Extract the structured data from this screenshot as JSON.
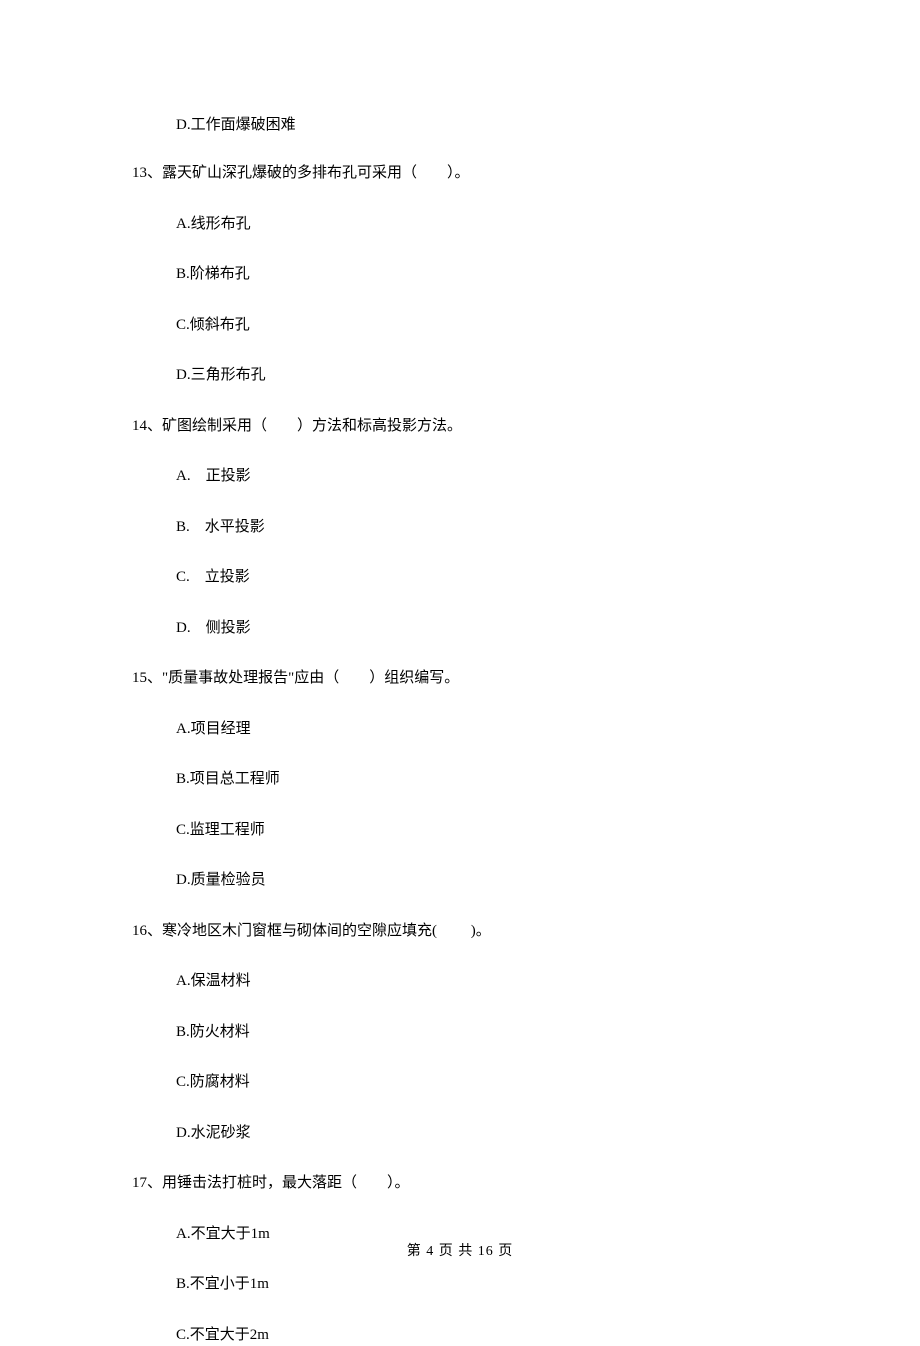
{
  "pre": {
    "option_d": "D.工作面爆破困难"
  },
  "q13": {
    "text": "13、露天矿山深孔爆破的多排布孔可采用（　　）。",
    "a": "A.线形布孔",
    "b": "B.阶梯布孔",
    "c": "C.倾斜布孔",
    "d": "D.三角形布孔"
  },
  "q14": {
    "text": "14、矿图绘制采用（　　）方法和标高投影方法。",
    "a": "A.　正投影",
    "b": "B.　水平投影",
    "c": "C.　立投影",
    "d": "D.　侧投影"
  },
  "q15": {
    "text": "15、\"质量事故处理报告\"应由（　　）组织编写。",
    "a": "A.项目经理",
    "b": "B.项目总工程师",
    "c": "C.监理工程师",
    "d": "D.质量检验员"
  },
  "q16": {
    "text": "16、寒冷地区木门窗框与砌体间的空隙应填充(　　 )。",
    "a": "A.保温材料",
    "b": "B.防火材料",
    "c": "C.防腐材料",
    "d": "D.水泥砂浆"
  },
  "q17": {
    "text": "17、用锤击法打桩时，最大落距（　　）。",
    "a": "A.不宜大于1m",
    "b": "B.不宜小于1m",
    "c": "C.不宜大于2m"
  },
  "footer": "第 4 页 共 16 页"
}
